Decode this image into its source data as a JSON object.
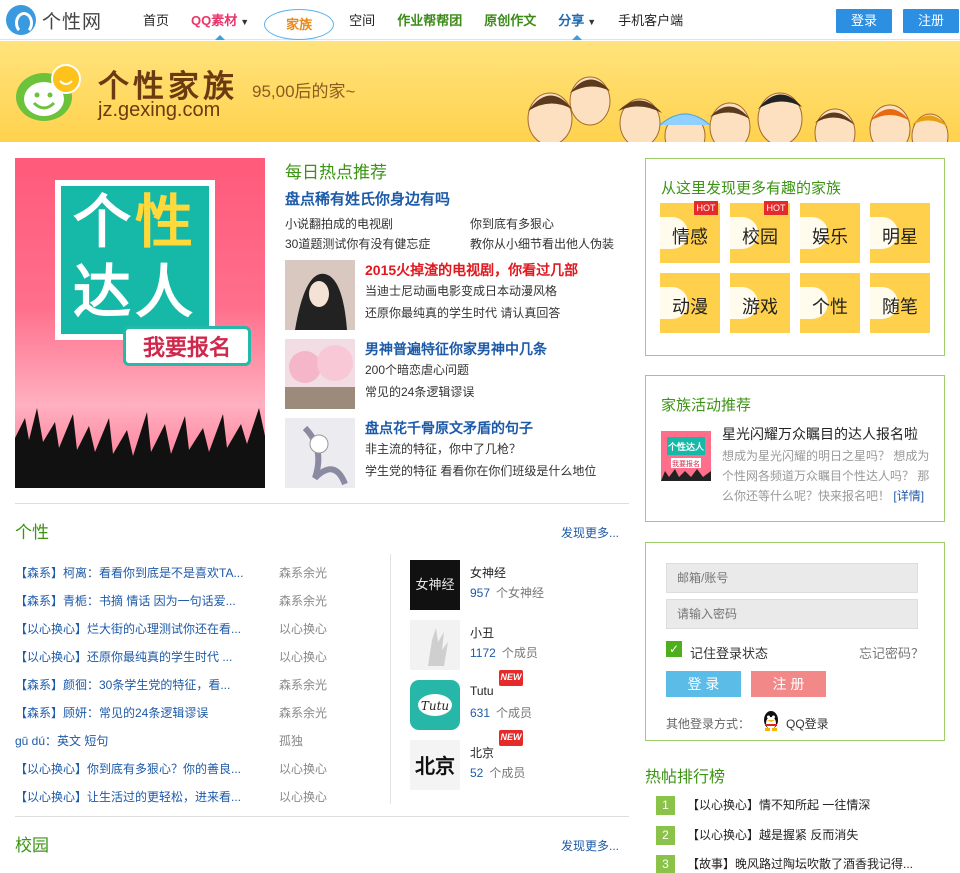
{
  "site": {
    "logo_text": "个性网"
  },
  "nav": {
    "items": [
      {
        "label": "首页"
      },
      {
        "label": "QQ素材"
      },
      {
        "label": "家族"
      },
      {
        "label": "空间"
      },
      {
        "label": "作业帮帮团"
      },
      {
        "label": "原创作文"
      },
      {
        "label": "分享"
      },
      {
        "label": "手机客户端"
      }
    ],
    "login": "登录",
    "register": "注册"
  },
  "banner": {
    "title": "个性家族",
    "subtitle": "95,00后的家~",
    "domain": "jz.gexing.com"
  },
  "hero": {
    "line1a": "个",
    "line1b": "性",
    "line2": "达人",
    "button": "我要报名"
  },
  "daily": {
    "heading": "每日热点推荐",
    "top_title": "盘点稀有姓氏你身边有吗",
    "links": [
      "小说翻拍成的电视剧",
      "你到底有多狠心",
      "30道题测试你有没有健忘症",
      "教你从小细节看出他人伪装"
    ],
    "items": [
      {
        "title": "2015火掉渣的电视剧，你看过几部",
        "l1": "当迪士尼动画电影变成日本动漫风格",
        "l2": "还原你最纯真的学生时代 请认真回答"
      },
      {
        "title": "男神普遍特征你家男神中几条",
        "l1": "200个暗恋虐心问题",
        "l2": "常见的24条逻辑谬误"
      },
      {
        "title": "盘点花千骨原文矛盾的句子",
        "l1": "非主流的特征，你中了几枪？",
        "l2": "学生党的特征 看看你在你们班级是什么地位"
      }
    ]
  },
  "section_gexing": {
    "title": "个性",
    "more": "发现更多...",
    "posts": [
      {
        "title": "【森系】柯离：看看你到底是不是喜欢TA...",
        "author": "森系余光"
      },
      {
        "title": "【森系】青栀：书摘 情话 因为一句话爱...",
        "author": "森系余光"
      },
      {
        "title": "【以心换心】烂大街的心理测试你还在看...",
        "author": "以心换心"
      },
      {
        "title": "【以心换心】还原你最纯真的学生时代 ...",
        "author": "以心换心"
      },
      {
        "title": "【森系】颜徊：30条学生党的特征，看...",
        "author": "森系余光"
      },
      {
        "title": "【森系】顾妍：常见的24条逻辑谬误",
        "author": "森系余光"
      },
      {
        "title": "gū dú：英文 短句",
        "author": "孤独"
      },
      {
        "title": "【以心换心】你到底有多狠心？你的善良...",
        "author": "以心换心"
      },
      {
        "title": "【以心换心】让生活过的更轻松，进来看...",
        "author": "以心换心"
      }
    ],
    "groups": [
      {
        "name": "女神经",
        "count": "957",
        "member_label": "个女神经",
        "new": "",
        "img_text": "女神经"
      },
      {
        "name": "小丑",
        "count": "1172",
        "member_label": "个成员",
        "new": "",
        "img_text": ""
      },
      {
        "name": "Tutu",
        "count": "631",
        "member_label": "个成员",
        "new": "NEW",
        "img_text": "Tutu"
      },
      {
        "name": "北京",
        "count": "52",
        "member_label": "个成员",
        "new": "NEW",
        "img_text": "北京"
      }
    ]
  },
  "section_xiaoyuan": {
    "title": "校园",
    "more": "发现更多..."
  },
  "discover": {
    "title": "从这里发现更多有趣的家族",
    "categories": [
      {
        "label": "情感",
        "hot": "HOT"
      },
      {
        "label": "校园",
        "hot": "HOT"
      },
      {
        "label": "娱乐",
        "hot": ""
      },
      {
        "label": "明星",
        "hot": ""
      },
      {
        "label": "动漫",
        "hot": ""
      },
      {
        "label": "游戏",
        "hot": ""
      },
      {
        "label": "个性",
        "hot": ""
      },
      {
        "label": "随笔",
        "hot": ""
      }
    ]
  },
  "activity": {
    "title": "家族活动推荐",
    "item_title": "星光闪耀万众瞩目的达人报名啦",
    "desc": "想成为星光闪耀的明日之星吗？ 想成为个性网各频道万众瞩目个性达人吗？ 那么你还等什么呢？快来报名吧！",
    "more": "[详情]",
    "thumb_line1": "个性达人",
    "thumb_line2": "我要报名"
  },
  "login": {
    "email_placeholder": "邮箱/账号",
    "password_placeholder": "请输入密码",
    "remember": "记住登录状态",
    "forgot": "忘记密码？",
    "login_btn": "登 录",
    "register_btn": "注 册",
    "other": "其他登录方式：",
    "qq": "QQ登录"
  },
  "ranking": {
    "title": "热帖排行榜",
    "items": [
      {
        "n": "1",
        "text": "【以心换心】情不知所起 一往情深"
      },
      {
        "n": "2",
        "text": "【以心换心】越是握紧 反而消失"
      },
      {
        "n": "3",
        "text": "【故事】晚风路过陶坛吹散了酒香我记得..."
      }
    ]
  }
}
